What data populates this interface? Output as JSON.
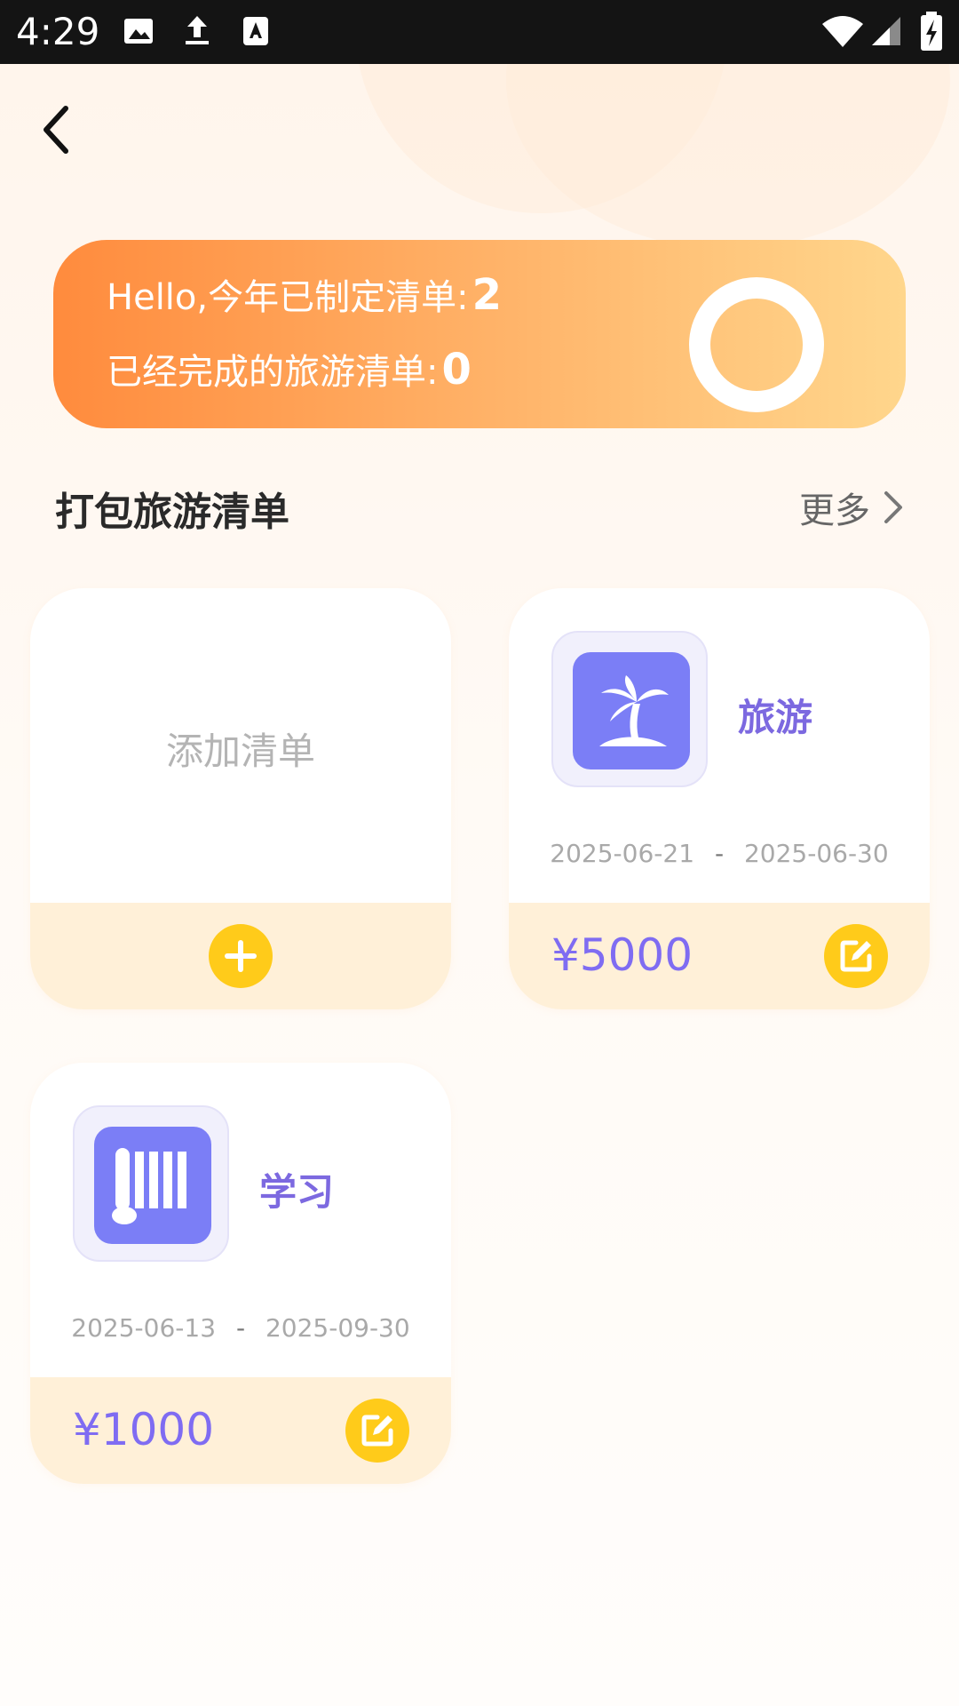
{
  "status_bar": {
    "time": "4:29"
  },
  "nav": {
    "back_icon": "chevron-left-icon"
  },
  "summary": {
    "line1_label": "Hello,今年已制定清单:",
    "line1_value": "2",
    "line2_label": "已经完成的旅游清单:",
    "line2_value": "0"
  },
  "section": {
    "title": "打包旅游清单",
    "more_label": "更多"
  },
  "add_card": {
    "label": "添加清单"
  },
  "lists": [
    {
      "name": "旅游",
      "icon": "palm-tree-icon",
      "start_date": "2025-06-21",
      "date_separator": "-",
      "end_date": "2025-06-30",
      "price": "¥5000"
    },
    {
      "name": "学习",
      "icon": "books-icon",
      "start_date": "2025-06-13",
      "date_separator": "-",
      "end_date": "2025-09-30",
      "price": "¥1000"
    }
  ],
  "colors": {
    "accent_orange": "#ff8b3d",
    "accent_yellow": "#ffcb1a",
    "accent_purple": "#7b7ef6",
    "price_purple": "#7f6cf2"
  }
}
